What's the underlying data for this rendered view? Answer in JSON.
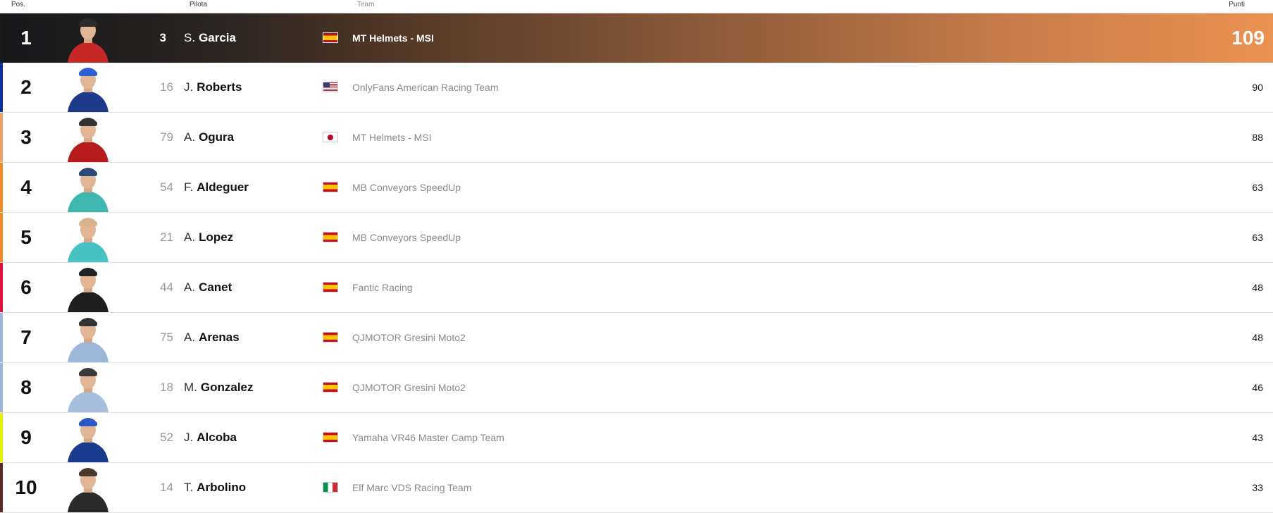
{
  "header": {
    "pos": "Pos.",
    "pilota": "Pilota",
    "team": "Team",
    "punti": "Punti"
  },
  "rows": [
    {
      "pos": "1",
      "number": "3",
      "initial": "S.",
      "surname": "Garcia",
      "team": "MT Helmets - MSI",
      "flag": "spain-flag",
      "points": "109",
      "stripe": "#1a1a1a",
      "suit": "#c62828",
      "helmet": "#2b2b2b"
    },
    {
      "pos": "2",
      "number": "16",
      "initial": "J.",
      "surname": "Roberts",
      "team": "OnlyFans American Racing Team",
      "flag": "usa-flag",
      "points": "90",
      "stripe": "#0b2f9a",
      "suit": "#1e3a8a",
      "helmet": "#2c5fcf"
    },
    {
      "pos": "3",
      "number": "79",
      "initial": "A.",
      "surname": "Ogura",
      "team": "MT Helmets - MSI",
      "flag": "japan-flag",
      "points": "88",
      "stripe": "#e9a66b",
      "suit": "#b71c1c",
      "helmet": "#333333"
    },
    {
      "pos": "4",
      "number": "54",
      "initial": "F.",
      "surname": "Aldeguer",
      "team": "MB Conveyors SpeedUp",
      "flag": "spain-flag",
      "points": "63",
      "stripe": "#f08a24",
      "suit": "#3fb7b0",
      "helmet": "#2d4b7a"
    },
    {
      "pos": "5",
      "number": "21",
      "initial": "A.",
      "surname": "Lopez",
      "team": "MB Conveyors SpeedUp",
      "flag": "spain-flag",
      "points": "63",
      "stripe": "#f08a24",
      "suit": "#48c1c4",
      "helmet": "#d9b38c"
    },
    {
      "pos": "6",
      "number": "44",
      "initial": "A.",
      "surname": "Canet",
      "team": "Fantic Racing",
      "flag": "spain-flag",
      "points": "48",
      "stripe": "#e0103a",
      "suit": "#1f1f1f",
      "helmet": "#222222"
    },
    {
      "pos": "7",
      "number": "75",
      "initial": "A.",
      "surname": "Arenas",
      "team": "QJMOTOR Gresini Moto2",
      "flag": "spain-flag",
      "points": "48",
      "stripe": "#9fb6dc",
      "suit": "#9ab6d8",
      "helmet": "#333333"
    },
    {
      "pos": "8",
      "number": "18",
      "initial": "M.",
      "surname": "Gonzalez",
      "team": "QJMOTOR Gresini Moto2",
      "flag": "spain-flag",
      "points": "46",
      "stripe": "#9fb6dc",
      "suit": "#a7bfdf",
      "helmet": "#3a3a3a"
    },
    {
      "pos": "9",
      "number": "52",
      "initial": "J.",
      "surname": "Alcoba",
      "team": "Yamaha VR46 Master Camp Team",
      "flag": "spain-flag",
      "points": "43",
      "stripe": "#e8f000",
      "suit": "#1b3b8f",
      "helmet": "#2b59c3"
    },
    {
      "pos": "10",
      "number": "14",
      "initial": "T.",
      "surname": "Arbolino",
      "team": "Elf Marc VDS Racing Team",
      "flag": "italy-flag",
      "points": "33",
      "stripe": "#5a2a2a",
      "suit": "#2a2a2a",
      "helmet": "#4a3a2a"
    }
  ]
}
